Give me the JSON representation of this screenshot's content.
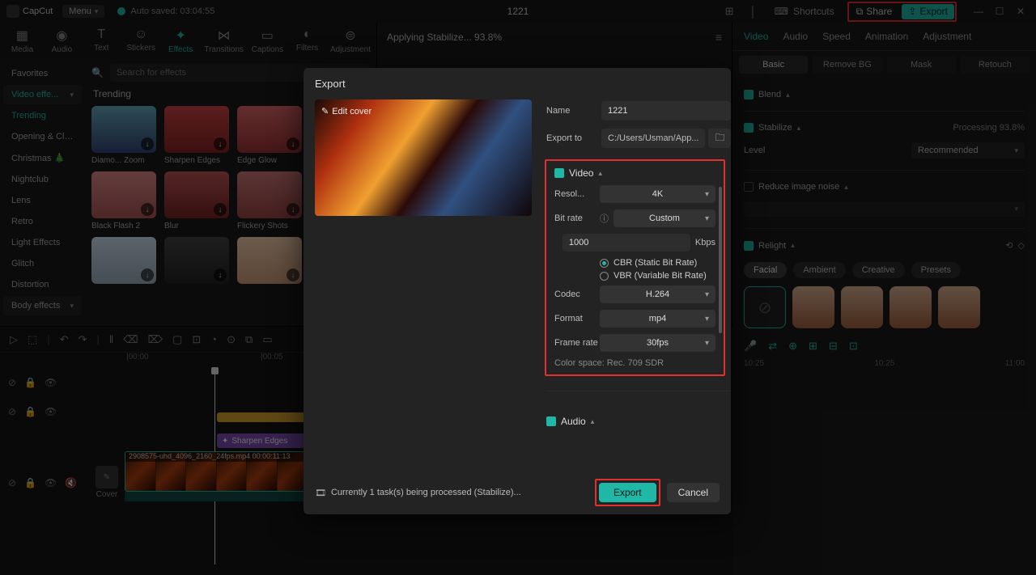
{
  "app": {
    "name": "CapCut",
    "menu": "Menu",
    "autosave": "Auto saved: 03:04:55",
    "title": "1221"
  },
  "titlebar": {
    "shortcuts": "Shortcuts",
    "share": "Share",
    "export": "Export"
  },
  "toolTabs": {
    "media": "Media",
    "audio": "Audio",
    "text": "Text",
    "stickers": "Stickers",
    "effects": "Effects",
    "transitions": "Transitions",
    "captions": "Captions",
    "filters": "Filters",
    "adjustment": "Adjustment"
  },
  "effects": {
    "searchPlaceholder": "Search for effects",
    "categories": [
      "Favorites",
      "Video effe...",
      "Trending",
      "Opening & Clo...",
      "Christmas 🎄",
      "Nightclub",
      "Lens",
      "Retro",
      "Light Effects",
      "Glitch",
      "Distortion",
      "Body effects"
    ],
    "sectionTitle": "Trending",
    "items": [
      {
        "label": "Diamo... Zoom"
      },
      {
        "label": "Sharpen Edges"
      },
      {
        "label": "Edge Glow"
      },
      {
        "label": "Black Flash 2"
      },
      {
        "label": "Blur"
      },
      {
        "label": "Flickery Shots"
      },
      {
        "label": ""
      },
      {
        "label": ""
      },
      {
        "label": ""
      }
    ]
  },
  "centerHeader": "Applying Stabilize... 93.8%",
  "propTabs": {
    "video": "Video",
    "audio": "Audio",
    "speed": "Speed",
    "animation": "Animation",
    "adjustment": "Adjustment"
  },
  "subTabs": {
    "basic": "Basic",
    "removebg": "Remove BG",
    "mask": "Mask",
    "retouch": "Retouch"
  },
  "propPanel": {
    "blend": "Blend",
    "stabilize": "Stabilize",
    "stabilizeStatus": "Processing 93.8%",
    "level": "Level",
    "levelVal": "Recommended",
    "reduceNoise": "Reduce image noise",
    "relight": "Relight",
    "pills": [
      "Facial",
      "Ambient",
      "Creative",
      "Presets"
    ],
    "rulerTicks": [
      "10:25",
      "10:25",
      "11:00"
    ]
  },
  "timeline": {
    "rulerTicks": [
      "|00:00",
      "|00:05"
    ],
    "cover": "Cover",
    "purpleClip": "Sharpen Edges",
    "videoClip": "2908575-uhd_4096_2160_24fps.mp4   00:00:11:13"
  },
  "modal": {
    "title": "Export",
    "editCover": "Edit cover",
    "nameLabel": "Name",
    "nameValue": "1221",
    "exportToLabel": "Export to",
    "exportToValue": "C:/Users/Usman/App...",
    "videoHead": "Video",
    "resLabel": "Resol...",
    "resVal": "4K",
    "brLabel": "Bit rate",
    "brVal": "Custom",
    "brInput": "1000",
    "brUnit": "Kbps",
    "cbr": "CBR (Static Bit Rate)",
    "vbr": "VBR (Variable Bit Rate)",
    "codecLabel": "Codec",
    "codecVal": "H.264",
    "formatLabel": "Format",
    "formatVal": "mp4",
    "fpsLabel": "Frame rate",
    "fpsVal": "30fps",
    "colorspace": "Color space: Rec. 709 SDR",
    "audioHead": "Audio",
    "taskStatus": "Currently 1 task(s) being processed (Stabilize)...",
    "exportBtn": "Export",
    "cancelBtn": "Cancel"
  }
}
